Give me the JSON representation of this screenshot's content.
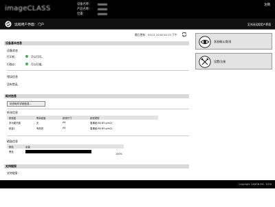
{
  "header": {
    "brand": "imageCLASS",
    "device_name_label": "设备名称：",
    "product_name_label": "产品名称：",
    "location_label": "位置：",
    "logout": "注销"
  },
  "title_bar": {
    "title": "远程用户界面：门户",
    "home_link": "至关闭远程用户界面"
  },
  "status": {
    "timestamp": "最后更新：05/11 2018 04:13 下午"
  },
  "device_basic": {
    "section_title": "设备基本信息",
    "status_title": "设备状态",
    "printer_label": "打印机：",
    "printer_status": "可以打印。",
    "scanner_label": "扫描仪：",
    "scanner_status": "可以扫描。",
    "error_title": "错误信息",
    "error_value": "没有错误。"
  },
  "consumables": {
    "section_title": "耗材信息",
    "check_button": "检查耗材详细信息...",
    "paper_title": "纸张信息",
    "paper_headers": [
      "纸张盒",
      "剩余纸量",
      "纸张尺寸",
      "纸张类型"
    ],
    "paper_rows": [
      [
        "多功能托盘",
        "无",
        "A4",
        "普通纸(60-89 g/m2)"
      ],
      [
        "纸盒1",
        "有纸张",
        "A4",
        "普通纸(60-89 g/m2)"
      ]
    ],
    "toner_title": "硒鼓信息",
    "toner_headers": [
      "颜色",
      "余量"
    ],
    "toner_color": "黑色",
    "toner_level": "100%"
  },
  "support": {
    "section_title": "支持链接",
    "link": "支持链接："
  },
  "side_panel": {
    "status_monitor": "状态确认/取消",
    "settings": "设置/注册"
  },
  "footer": {
    "copyright": "Copyright CANON INC. 2016"
  },
  "colors": {
    "header_bg": "#000000",
    "status_ok": "#3fb14b",
    "section_bg": "#d9d9d9"
  }
}
